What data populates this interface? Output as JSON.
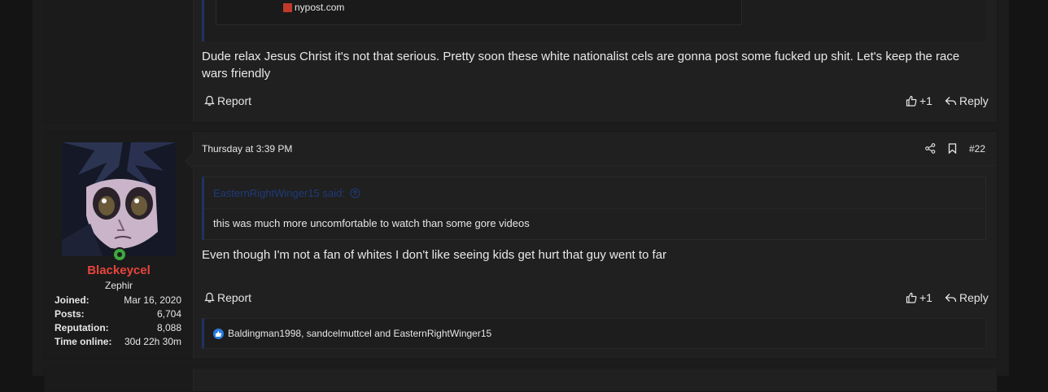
{
  "post1": {
    "embed_source": "nypost.com",
    "message": "Dude relax Jesus Christ it's not that serious. Pretty soon these white nationalist cels are gonna post some fucked up shit. Let's keep the race wars friendly",
    "report_label": "Report",
    "like_count": "+1",
    "reply_label": "Reply"
  },
  "post2": {
    "user": {
      "username": "Blackeycel",
      "title": "Zephir",
      "stats": [
        {
          "key": "Joined:",
          "value": "Mar 16, 2020"
        },
        {
          "key": "Posts:",
          "value": "6,704"
        },
        {
          "key": "Reputation:",
          "value": "8,088"
        },
        {
          "key": "Time online:",
          "value": "30d 22h 30m"
        }
      ]
    },
    "date": "Thursday at 3:39 PM",
    "post_number": "#22",
    "quote": {
      "author": "EasternRightWinger15 said:",
      "text": "this was much more uncomfortable to watch than some gore videos"
    },
    "message": "Even though I'm not a fan of whites I don't like seeing kids get hurt that guy went to far",
    "report_label": "Report",
    "like_count": "+1",
    "reply_label": "Reply",
    "reactions_users": "Baldingman1998, sandcelmuttcel and EasternRightWinger15"
  },
  "colors": {
    "username": "#e8453c",
    "online": "#3fa83f",
    "quote_accent": "#1f3264",
    "like_icon": "#2a7de1"
  }
}
